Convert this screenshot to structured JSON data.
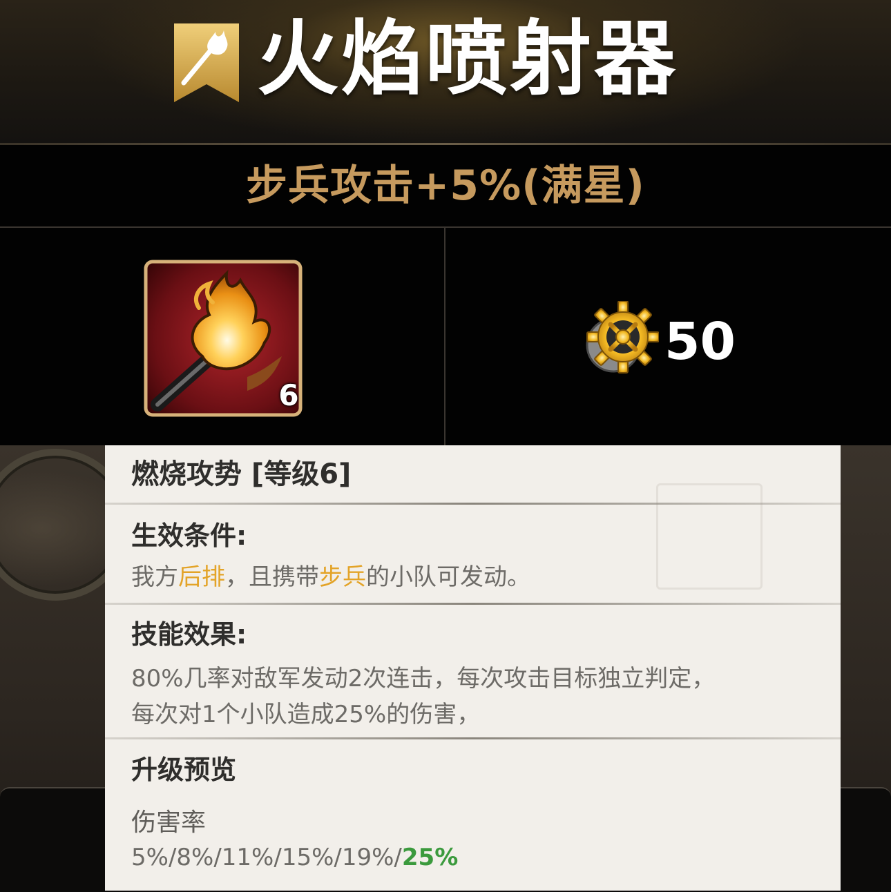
{
  "header": {
    "title": "火焰喷射器",
    "badge_icon": "torch-badge-icon"
  },
  "subtitle": "步兵攻击+5%(满星)",
  "skill": {
    "icon": "flaming-torch-icon",
    "level": "6"
  },
  "cost": {
    "icon": "gear-icon",
    "value": "50"
  },
  "tooltip": {
    "skill_title": "燃烧攻势 [等级6]",
    "condition_heading": "生效条件:",
    "condition_text": {
      "part1": "我方",
      "hl1": "后排",
      "part2": "，且携带",
      "hl2": "步兵",
      "part3": "的小队可发动。"
    },
    "effect_heading": "技能效果:",
    "effect_line1": "80%几率对敌军发动2次连击，每次攻击目标独立判定，",
    "effect_line2": "每次对1个小队造成25%的伤害，",
    "upgrade_heading": "升级预览",
    "upgrade_label": "伤害率",
    "upgrade_values": "5%/8%/11%/15%/19%/",
    "upgrade_final": "25%"
  },
  "colors": {
    "subtitle_gold": "#c69a5e",
    "highlight_orange": "#e3a327",
    "final_green": "#3b9a3d"
  }
}
